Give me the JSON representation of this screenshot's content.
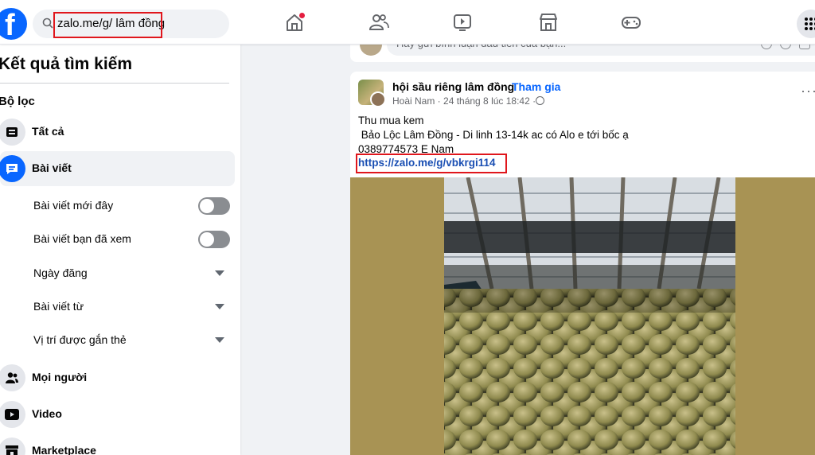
{
  "search": {
    "query": "zalo.me/g/ lâm đồng"
  },
  "brand": {
    "logo_letter": "f",
    "color": "#0866ff"
  },
  "nav": {
    "icons": [
      "home-icon",
      "friends-icon",
      "watch-icon",
      "marketplace-icon",
      "gaming-icon",
      "menu-grid-icon"
    ],
    "active_notification": "home"
  },
  "sidebar": {
    "title": "Kết quả tìm kiếm",
    "filter_heading": "Bộ lọc",
    "items": [
      {
        "label": "Tất cả",
        "icon": "feed-icon",
        "active": false
      },
      {
        "label": "Bài viết",
        "icon": "posts-icon",
        "active": true
      },
      {
        "label": "Mọi người",
        "icon": "people-icon",
        "active": false
      },
      {
        "label": "Video",
        "icon": "video-icon",
        "active": false
      },
      {
        "label": "Marketplace",
        "icon": "marketplace-icon",
        "active": false
      }
    ],
    "sub_filters": [
      {
        "label": "Bài viết mới đây",
        "control": "toggle",
        "on": false
      },
      {
        "label": "Bài viết bạn đã xem",
        "control": "toggle",
        "on": false
      },
      {
        "label": "Ngày đăng",
        "control": "dropdown"
      },
      {
        "label": "Bài viết từ",
        "control": "dropdown"
      },
      {
        "label": "Vị trí được gắn thẻ",
        "control": "dropdown"
      }
    ]
  },
  "previous_post": {
    "comment_placeholder": "Hãy gửi bình luận đầu tiên của bạn..."
  },
  "post": {
    "group_name": "hội sầu riêng lâm đồng",
    "separator": "·",
    "join_label": "Tham gia",
    "meta": "Hoài Nam · 24 tháng 8 lúc 18:42 ·",
    "lines": [
      "Thu mua kem",
      " Bảo Lộc Lâm Đồng - Di linh 13-14k ac có Alo e tới bốc ạ",
      "0389774573 E Nam"
    ],
    "link": "https://zalo.me/g/vbkrgi114",
    "more_label": "···"
  },
  "colors": {
    "highlight": "#e0161c",
    "link": "#1a4fb3",
    "accent": "#0866ff"
  }
}
